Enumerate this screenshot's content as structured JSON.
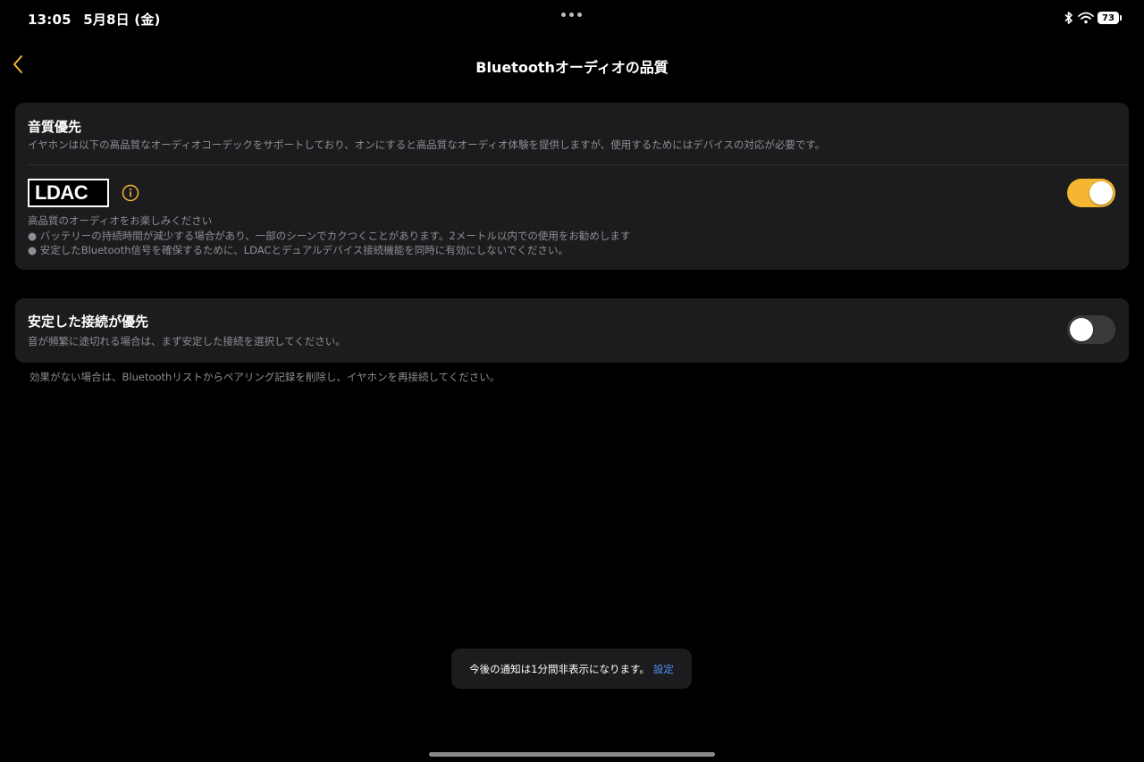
{
  "status_bar": {
    "time": "13:05",
    "date": "5月8日 (金)",
    "battery": "73"
  },
  "nav": {
    "title": "Bluetoothオーディオの品質"
  },
  "quality_section": {
    "title": "音質優先",
    "description": "イヤホンは以下の高品質なオーディオコーデックをサポートしており、オンにすると高品質なオーディオ体験を提供しますが、使用するためにはデバイスの対応が必要です。",
    "ldac_logo_text": "LDAC",
    "ldac_enabled": true,
    "ldac_lines": [
      "高品質のオーディオをお楽しみください",
      "● バッテリーの持続時間が減少する場合があり、一部のシーンでカクつくことがあります。2メートル以内での使用をお勧めします",
      "● 安定したBluetooth信号を確保するために、LDACとデュアルデバイス接続機能を同時に有効にしないでください。"
    ]
  },
  "stable_section": {
    "title": "安定した接続が優先",
    "description": "音が頻繁に途切れる場合は、まず安定した接続を選択してください。",
    "enabled": false
  },
  "footnote": "効果がない場合は、Bluetoothリストからペアリング記録を削除し、イヤホンを再接続してください。",
  "toast": {
    "message": "今後の通知は1分間非表示になります。",
    "link_label": "設定"
  },
  "colors": {
    "background": "#000000",
    "card": "#1c1c1e",
    "accent_toggle": "#f5b731",
    "link": "#4d8ff5",
    "secondary_text": "#8e8e93"
  },
  "icons": {
    "back": "chevron-left-icon",
    "info": "info-circle-icon",
    "bluetooth": "bluetooth-icon",
    "wifi": "wifi-icon",
    "battery": "battery-icon"
  }
}
